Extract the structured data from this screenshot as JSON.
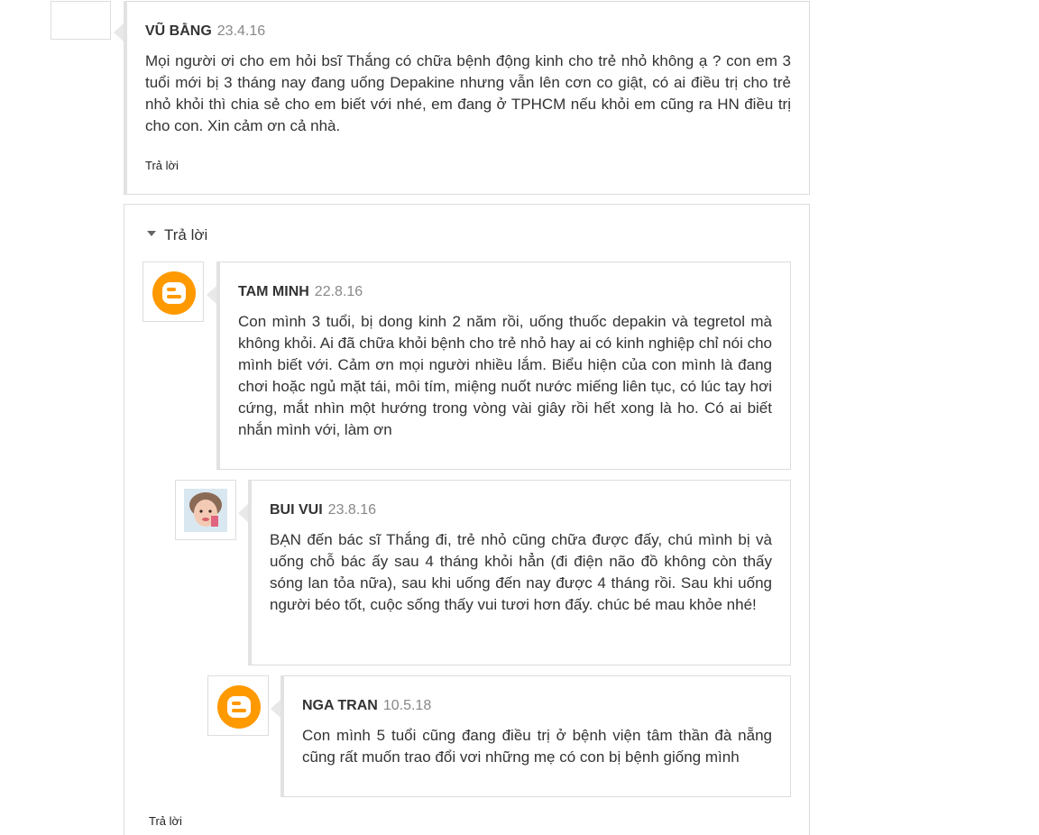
{
  "comments": [
    {
      "author": "VŨ BẰNG",
      "date": "23.4.16",
      "text": "Mọi người ơi cho em hỏi bsĩ Thắng có chữa bệnh động kinh cho trẻ nhỏ không ạ ? con em 3 tuổi mới bị 3 tháng nay đang uống Depakine nhưng vẫn lên cơn co giật, có ai điều trị cho trẻ nhỏ khỏi thì chia sẻ cho em biết với nhé, em đang ở TPHCM nếu khỏi em cũng ra HN điều trị cho con. Xin cảm ơn cả nhà.",
      "reply_label": "Trả lời",
      "avatar": "none"
    }
  ],
  "thread": {
    "toggle_label": "Trả lời",
    "replies": [
      {
        "author": "TAM MINH",
        "date": "22.8.16",
        "text": "Con mình 3 tuổi, bị dong kinh 2 năm rồi, uống thuốc depakin và tegretol mà không khỏi. Ai đã chữa khỏi bệnh cho trẻ nhỏ hay ai có kinh nghiệp chỉ nói cho mình biết với. Cảm ơn mọi người nhiều lắm. Biểu hiện của con mình là đang chơi hoặc ngủ mặt tái, môi tím, miệng nuốt nước miếng liên tục, có lúc tay hơi cứng, mắt nhìn một hướng trong vòng vài giây rồi hết xong là ho. Có ai biết nhắn mình với, làm ơn",
        "avatar": "blogger-icon"
      },
      {
        "author": "BUI VUI",
        "date": "23.8.16",
        "text": "BẠN đến bác sĩ Thắng đi, trẻ nhỏ cũng chữa được đấy, chú mình bị và uống chỗ bác ấy sau 4 tháng khỏi hẳn (đi điện não đồ không còn thấy sóng lan tỏa nữa), sau khi uống đến nay được 4 tháng rồi. Sau khi uống người béo tốt, cuộc sống thấy vui tươi hơn đấy. chúc bé mau khỏe nhé!",
        "avatar": "child-photo"
      },
      {
        "author": "NGA TRAN",
        "date": "10.5.18",
        "text": "Con mình 5 tuổi cũng đang điều trị ở bệnh viện tâm thần đà nẵng cũng rất muốn trao đổi vơi những mẹ có con bị bệnh giống mình",
        "avatar": "blogger-icon"
      }
    ],
    "reply_label": "Trả lời"
  },
  "colors": {
    "blogger_orange": "#ff9900",
    "card_border": "#dcdcdc",
    "left_border": "#e2e2e2"
  }
}
